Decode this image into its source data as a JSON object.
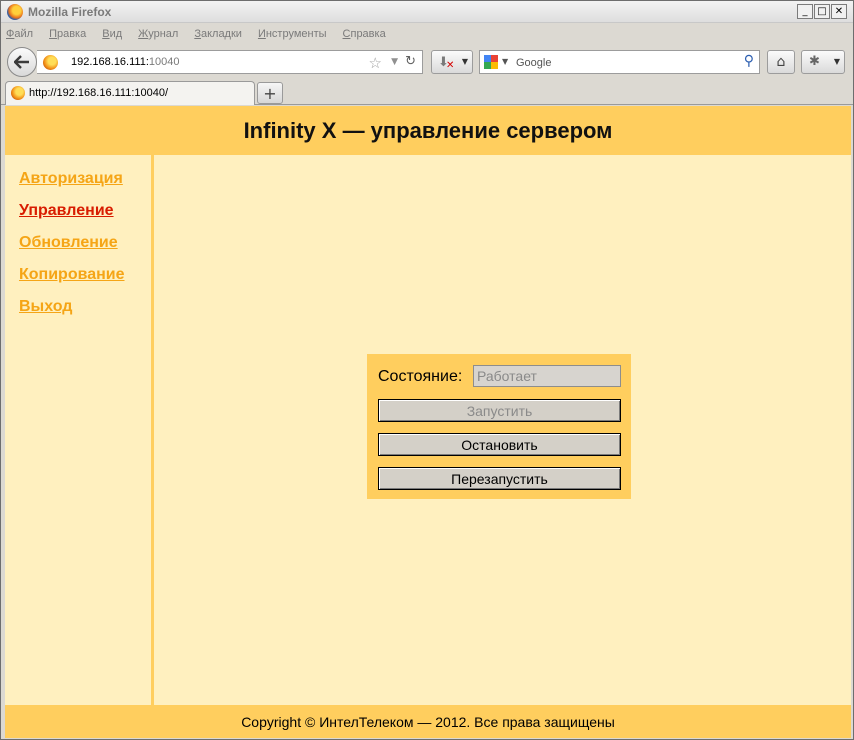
{
  "window": {
    "title": "Mozilla Firefox",
    "controls": [
      "_",
      "□",
      "✕"
    ]
  },
  "menu": {
    "items": [
      "Файл",
      "Правка",
      "Вид",
      "Журнал",
      "Закладки",
      "Инструменты",
      "Справка"
    ]
  },
  "navbar": {
    "url_host": "192.168.16.111:",
    "url_port": "10040",
    "search_placeholder": "Google"
  },
  "tabs": [
    {
      "label": "http://192.168.16.111:10040/"
    }
  ],
  "page": {
    "title": "Infinity X — управление сервером",
    "nav": [
      {
        "label": "Авторизация",
        "active": false
      },
      {
        "label": "Управление",
        "active": true
      },
      {
        "label": "Обновление",
        "active": false
      },
      {
        "label": "Копирование",
        "active": false
      },
      {
        "label": "Выход",
        "active": false
      }
    ],
    "control": {
      "status_label": "Состояние:",
      "status_value": "Работает",
      "start_label": "Запустить",
      "stop_label": "Остановить",
      "restart_label": "Перезапустить"
    },
    "footer": "Copyright © ИнтелТелеком — 2012. Все права защищены"
  },
  "colors": {
    "header_bg": "#ffce5e",
    "page_bg": "#fff0bf",
    "link": "#f5a516",
    "link_active": "#d81c00"
  }
}
